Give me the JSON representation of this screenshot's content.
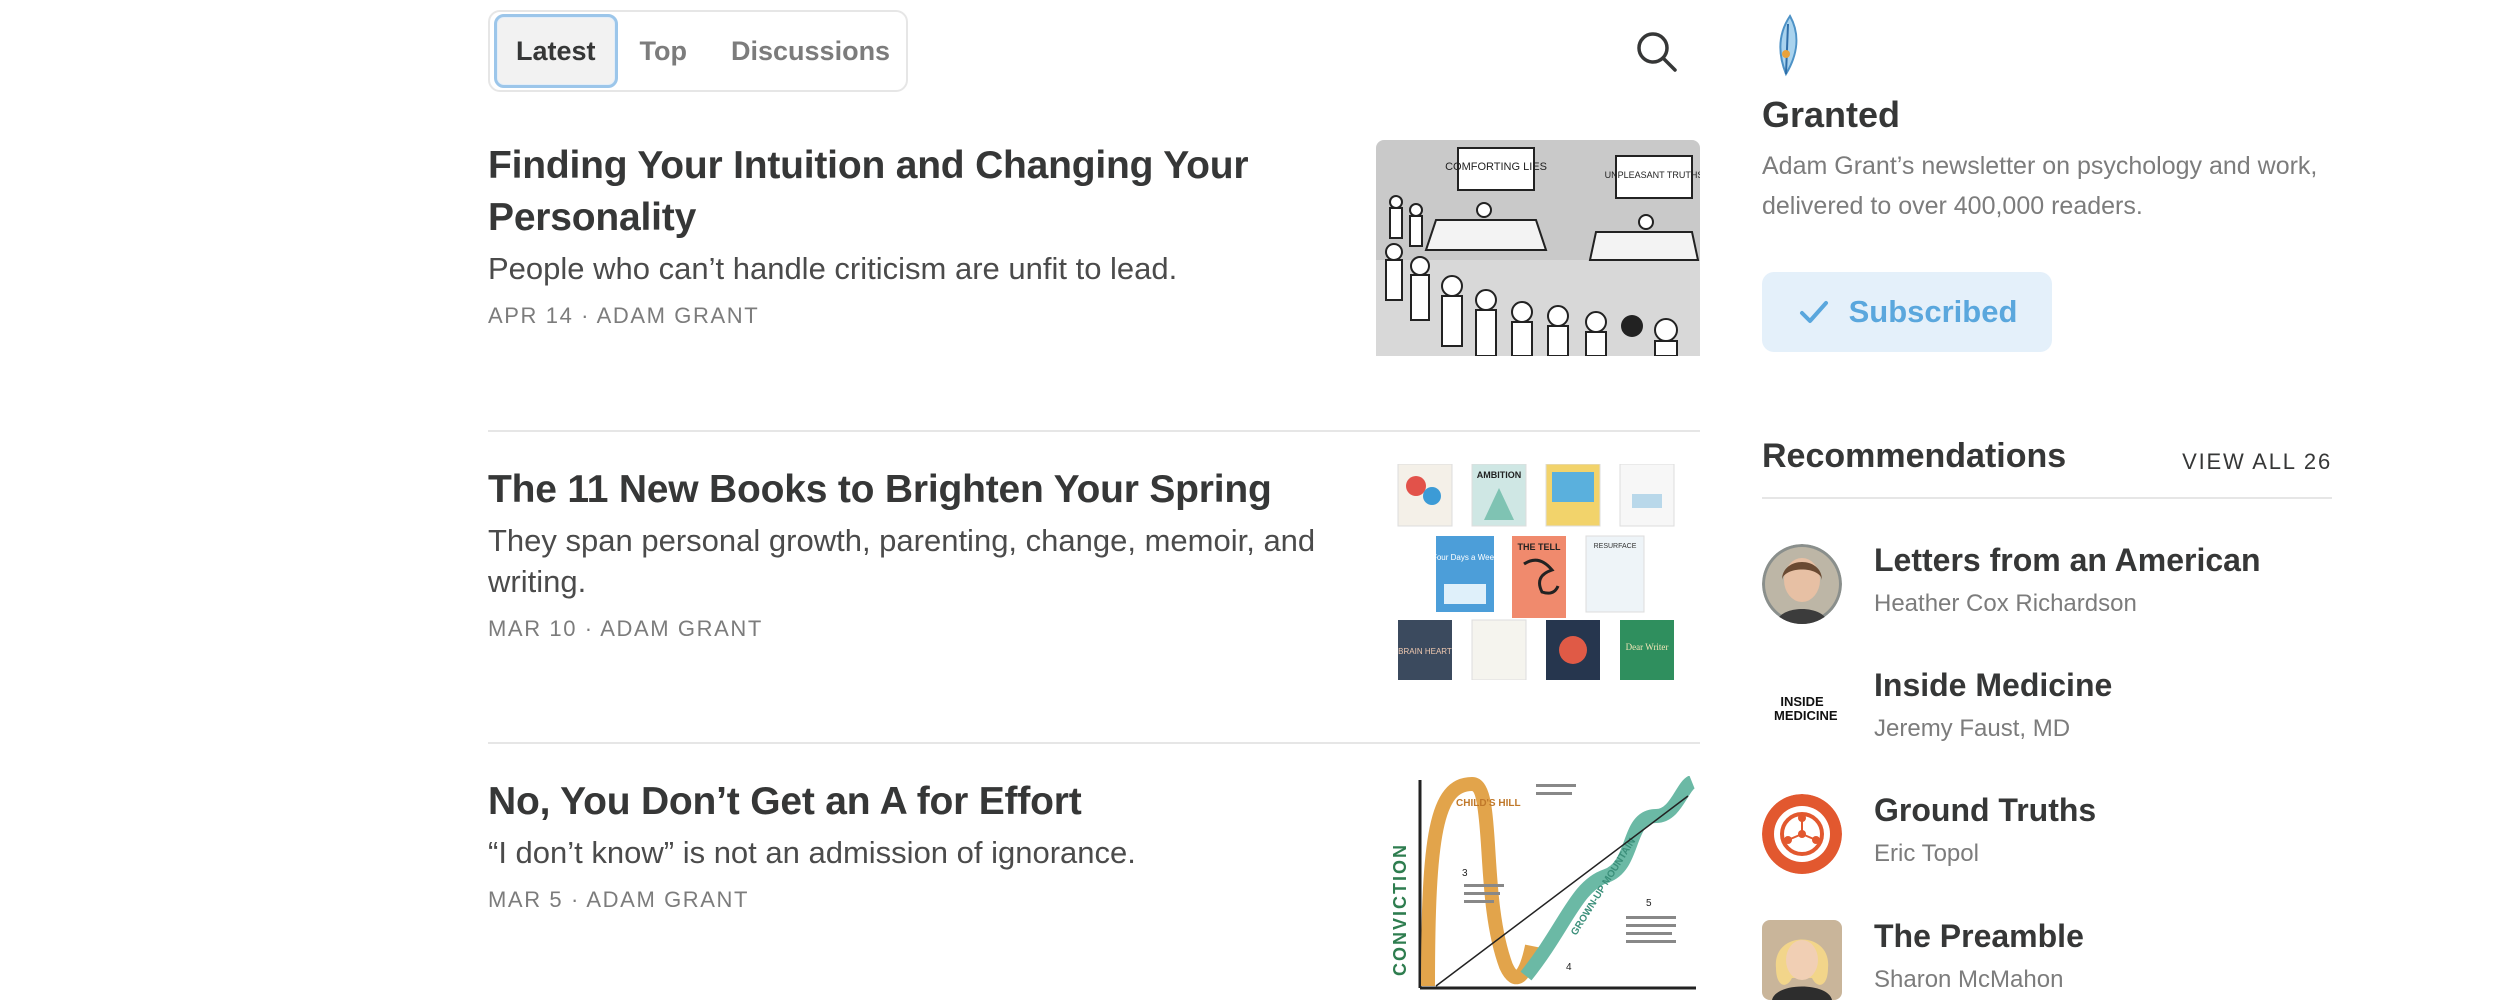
{
  "tabs": [
    {
      "label": "Latest",
      "active": true
    },
    {
      "label": "Top",
      "active": false
    },
    {
      "label": "Discussions",
      "active": false
    }
  ],
  "search": {
    "icon": "search-icon"
  },
  "posts": [
    {
      "title": "Finding Your Intuition and Changing Your Personality",
      "subtitle": "People who can’t handle criticism are unfit to lead.",
      "date": "APR 14",
      "author": "ADAM GRANT",
      "thumb_labels": [
        "COMFORTING LIES",
        "UNPLEASANT TRUTHS"
      ]
    },
    {
      "title": "The 11 New Books to Brighten Your Spring",
      "subtitle": "They span personal growth, parenting, change, memoir, and writing.",
      "date": "MAR 10",
      "author": "ADAM GRANT",
      "thumb_labels": [
        "AMBITION",
        "Four Days a Week",
        "THE TELL",
        "RESURFACE",
        "BRAIN HEART",
        "Dear Writer"
      ]
    },
    {
      "title": "No, You Don’t Get an A for Effort",
      "subtitle": "“I don’t know” is not an admission of ignorance.",
      "date": "MAR 5",
      "author": "ADAM GRANT",
      "thumb_labels": [
        "CONVICTION",
        "CHILD'S HILL",
        "GROWN-UP MOUNTAIN",
        "3",
        "4",
        "5"
      ]
    }
  ],
  "publication": {
    "name": "Granted",
    "description": "Adam Grant’s newsletter on psychology and work, delivered to over 400,000 readers.",
    "subscribe_label": "Subscribed",
    "subscribe_icon": "check-icon",
    "accent_color": "#5aa7dd"
  },
  "recommendations": {
    "title": "Recommendations",
    "view_all": "VIEW ALL 26",
    "items": [
      {
        "name": "Letters from an American",
        "author": "Heather Cox Richardson",
        "avatar_text": ""
      },
      {
        "name": "Inside Medicine",
        "author": "Jeremy Faust, MD",
        "avatar_text": "INSIDE MEDICINE"
      },
      {
        "name": "Ground Truths",
        "author": "Eric Topol",
        "avatar_text": ""
      },
      {
        "name": "The Preamble",
        "author": "Sharon McMahon",
        "avatar_text": ""
      }
    ]
  }
}
